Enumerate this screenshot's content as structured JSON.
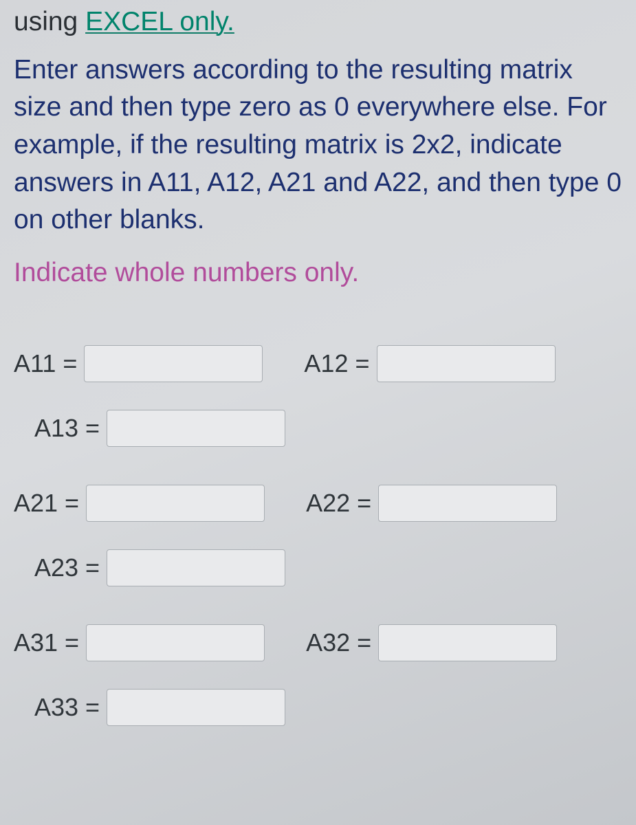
{
  "header": {
    "prefix": "using ",
    "emph": "EXCEL only."
  },
  "instructions_text": "Enter answers according to the resulting matrix size and then type zero as 0 everywhere else. For example, if the resulting matrix is 2x2, indicate answers in A11, A12, A21 and A22, and then type 0 on other blanks.",
  "whole_numbers_text": "Indicate whole numbers only.",
  "fields": {
    "a11": {
      "label": "A11 =",
      "value": ""
    },
    "a12": {
      "label": "A12 =",
      "value": ""
    },
    "a13": {
      "label": "A13 =",
      "value": ""
    },
    "a21": {
      "label": "A21 =",
      "value": ""
    },
    "a22": {
      "label": "A22 =",
      "value": ""
    },
    "a23": {
      "label": "A23 =",
      "value": ""
    },
    "a31": {
      "label": "A31 =",
      "value": ""
    },
    "a32": {
      "label": "A32 =",
      "value": ""
    },
    "a33": {
      "label": "A33 =",
      "value": ""
    }
  }
}
